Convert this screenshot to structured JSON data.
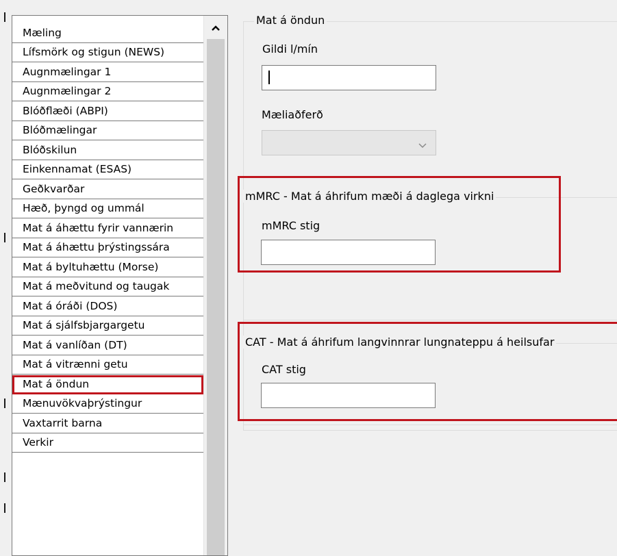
{
  "list": {
    "items": [
      {
        "label": "Mæling"
      },
      {
        "label": "Lífsmörk og stigun (NEWS)"
      },
      {
        "label": "Augnmælingar 1"
      },
      {
        "label": "Augnmælingar 2"
      },
      {
        "label": "Blóðflæði (ABPI)"
      },
      {
        "label": "Blóðmælingar"
      },
      {
        "label": "Blóðskilun"
      },
      {
        "label": "Einkennamat (ESAS)"
      },
      {
        "label": "Geðkvarðar"
      },
      {
        "label": "Hæð, þyngd og ummál"
      },
      {
        "label": "Mat á áhættu fyrir vannærin"
      },
      {
        "label": "Mat á áhættu þrýstingssára"
      },
      {
        "label": "Mat á byltuhættu (Morse)"
      },
      {
        "label": "Mat á meðvitund og taugak"
      },
      {
        "label": "Mat á óráði (DOS)"
      },
      {
        "label": "Mat á sjálfsbjargargetu"
      },
      {
        "label": "Mat á vanlíðan (DT)"
      },
      {
        "label": "Mat á vitrænni getu"
      },
      {
        "label": "Mat á öndun"
      },
      {
        "label": "Mænuvökvaþrýstingur"
      },
      {
        "label": "Vaxtarrit barna"
      },
      {
        "label": "Verkir"
      }
    ],
    "selected_label": "Mat á öndun"
  },
  "breathing": {
    "group_title": "Mat á öndun",
    "flow_label": "Gildi l/mín",
    "flow_value": "",
    "method_label": "Mæliaðferð",
    "method_value": ""
  },
  "mmrc": {
    "group_title": "mMRC - Mat á áhrifum mæði á daglega virkni",
    "score_label": "mMRC stig",
    "score_value": ""
  },
  "cat": {
    "group_title": "CAT - Mat á áhrifum langvinnrar lungnateppu á heilsufar",
    "score_label": "CAT stig",
    "score_value": ""
  },
  "colors": {
    "highlight": "#c0151d",
    "window_bg": "#f0f0f0"
  },
  "icons": {
    "scroll_up": "chevron-up-icon",
    "combo_arrow": "chevron-down-icon"
  }
}
